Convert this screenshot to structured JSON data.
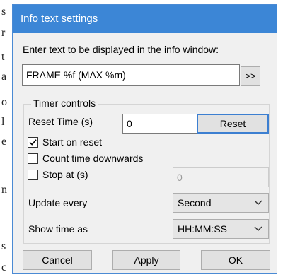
{
  "background": {
    "glyphs": [
      "s",
      "r",
      "t",
      "a",
      "o",
      "l",
      "e",
      "n",
      "s",
      "c"
    ]
  },
  "dialog": {
    "title": "Info text settings",
    "prompt": "Enter text to be displayed in the info window:",
    "info_text_value": "FRAME %f (MAX %m)",
    "expand_button": ">>",
    "timer_group": {
      "title": "Timer controls",
      "reset_time_label": "Reset Time (s)",
      "reset_time_value": "0",
      "reset_button": "Reset",
      "start_on_reset": {
        "label": "Start on reset",
        "checked": true
      },
      "count_down": {
        "label": "Count time downwards",
        "checked": false
      },
      "stop_at": {
        "label": "Stop at (s)",
        "checked": false,
        "value": "0"
      },
      "update_every": {
        "label": "Update every",
        "selected": "Second"
      },
      "show_time_as": {
        "label": "Show time as",
        "selected": "HH:MM:SS"
      }
    },
    "buttons": {
      "cancel": "Cancel",
      "apply": "Apply",
      "ok": "OK"
    }
  },
  "colors": {
    "title_bar": "#3c86d6",
    "dialog_bg": "#f0f0f0",
    "focus_border": "#3c7fd1"
  }
}
